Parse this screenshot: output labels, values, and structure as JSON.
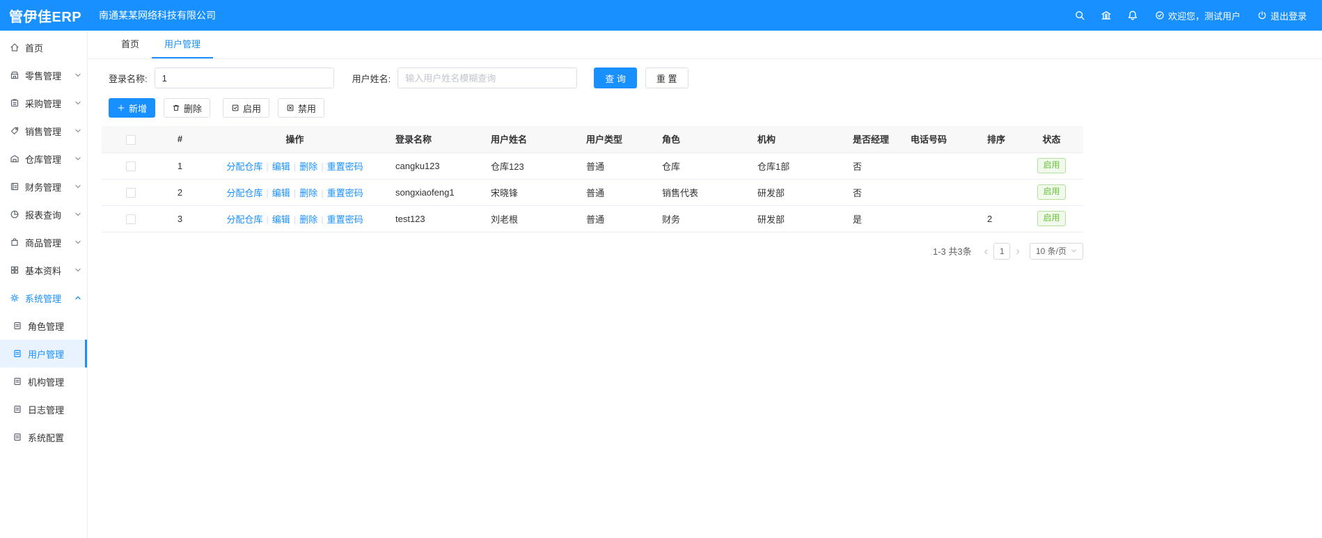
{
  "colors": {
    "primary": "#1890ff",
    "success": "#67c23a"
  },
  "header": {
    "logo": "管伊佳ERP",
    "company": "南通某某网络科技有限公司",
    "icons": [
      "search",
      "bank",
      "bell"
    ],
    "welcome": "欢迎您，测试用户",
    "logout": "退出登录"
  },
  "sidebar": {
    "items": [
      {
        "id": "home",
        "icon": "home",
        "label": "首页",
        "expandable": false
      },
      {
        "id": "retail",
        "icon": "retail",
        "label": "零售管理",
        "expandable": true
      },
      {
        "id": "purchase",
        "icon": "purchase",
        "label": "采购管理",
        "expandable": true
      },
      {
        "id": "sales",
        "icon": "sales",
        "label": "销售管理",
        "expandable": true
      },
      {
        "id": "warehouse",
        "icon": "warehouse",
        "label": "仓库管理",
        "expandable": true
      },
      {
        "id": "finance",
        "icon": "finance",
        "label": "财务管理",
        "expandable": true
      },
      {
        "id": "report",
        "icon": "report",
        "label": "报表查询",
        "expandable": true
      },
      {
        "id": "product",
        "icon": "product",
        "label": "商品管理",
        "expandable": true
      },
      {
        "id": "basic-data",
        "icon": "basic",
        "label": "基本资料",
        "expandable": true
      },
      {
        "id": "system",
        "icon": "system",
        "label": "系统管理",
        "expandable": true,
        "expanded": true,
        "active": true,
        "children": [
          {
            "id": "role-management",
            "label": "角色管理"
          },
          {
            "id": "user-management",
            "label": "用户管理",
            "active": true
          },
          {
            "id": "org-management",
            "label": "机构管理"
          },
          {
            "id": "log-management",
            "label": "日志管理"
          },
          {
            "id": "system-config",
            "label": "系统配置"
          }
        ]
      }
    ]
  },
  "tabs": [
    {
      "id": "home",
      "label": "首页"
    },
    {
      "id": "user-management",
      "label": "用户管理",
      "active": true
    }
  ],
  "search": {
    "login_label": "登录名称:",
    "login_value": "1",
    "name_label": "用户姓名:",
    "name_placeholder": "输入用户姓名模糊查询",
    "query_label": "查 询",
    "reset_label": "重 置"
  },
  "toolbar": {
    "add_label": "新增",
    "delete_label": "删除",
    "enable_label": "启用",
    "disable_label": "禁用"
  },
  "table": {
    "headers": [
      {
        "key": "index",
        "label": "#",
        "align": "center"
      },
      {
        "key": "ops",
        "label": "操作",
        "align": "center"
      },
      {
        "key": "login",
        "label": "登录名称"
      },
      {
        "key": "name",
        "label": "用户姓名"
      },
      {
        "key": "type",
        "label": "用户类型"
      },
      {
        "key": "role",
        "label": "角色"
      },
      {
        "key": "org",
        "label": "机构"
      },
      {
        "key": "manager",
        "label": "是否经理"
      },
      {
        "key": "phone",
        "label": "电话号码"
      },
      {
        "key": "sort",
        "label": "排序"
      },
      {
        "key": "status",
        "label": "状态",
        "align": "center"
      }
    ],
    "op_links": [
      {
        "id": "assign-warehouse",
        "label": "分配仓库"
      },
      {
        "id": "edit",
        "label": "编辑"
      },
      {
        "id": "delete",
        "label": "删除"
      },
      {
        "id": "reset-password",
        "label": "重置密码"
      }
    ],
    "rows": [
      {
        "index": "1",
        "login": "cangku123",
        "name": "仓库123",
        "type": "普通",
        "role": "仓库",
        "org": "仓库1部",
        "manager": "否",
        "phone": "",
        "sort": "",
        "status": "启用"
      },
      {
        "index": "2",
        "login": "songxiaofeng1",
        "name": "宋晓锋",
        "type": "普通",
        "role": "销售代表",
        "org": "研发部",
        "manager": "否",
        "phone": "",
        "sort": "",
        "status": "启用"
      },
      {
        "index": "3",
        "login": "test123",
        "name": "刘老根",
        "type": "普通",
        "role": "财务",
        "org": "研发部",
        "manager": "是",
        "phone": "",
        "sort": "2",
        "status": "启用"
      }
    ]
  },
  "pagination": {
    "summary": "1-3 共3条",
    "prev": "‹",
    "current_page": "1",
    "next": "›",
    "page_size": "10 条/页"
  }
}
